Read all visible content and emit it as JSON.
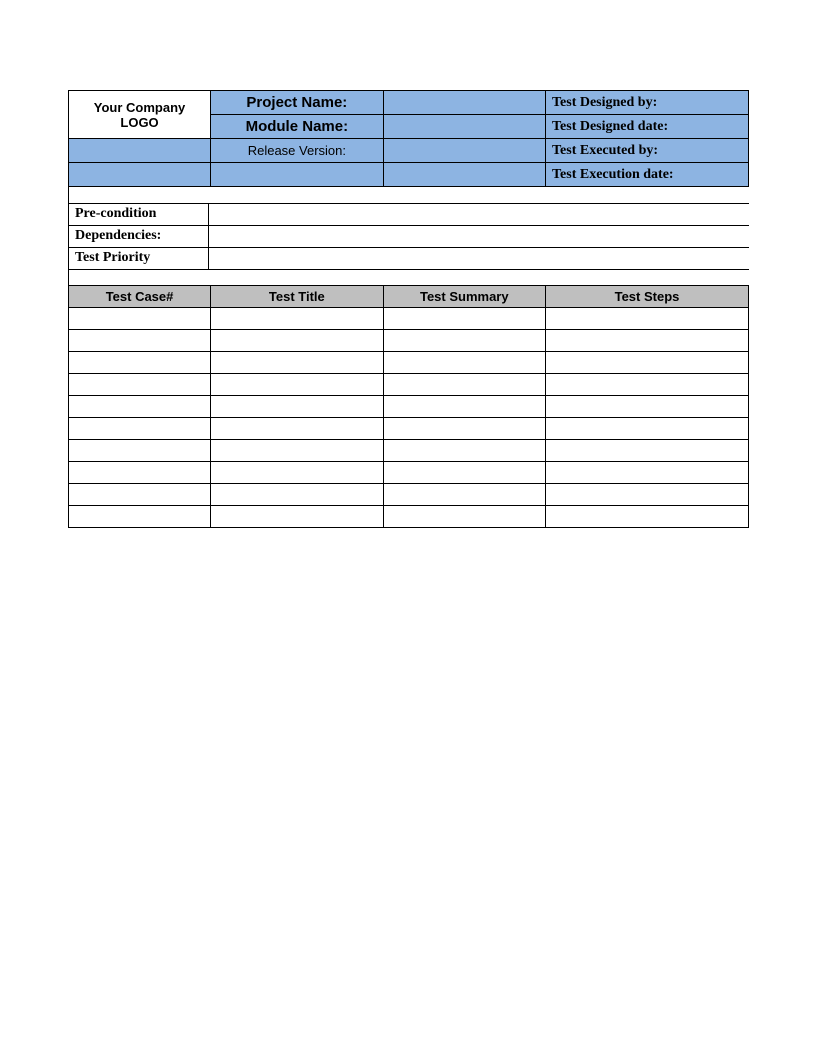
{
  "header": {
    "logo_text": "Your Company LOGO",
    "project_name_label": "Project Name:",
    "module_name_label": "Module Name:",
    "release_version_label": "Release Version:",
    "test_designed_by_label": "Test Designed by:",
    "test_designed_date_label": "Test Designed date:",
    "test_executed_by_label": "Test Executed by:",
    "test_execution_date_label": "Test Execution date:",
    "project_name_value": "",
    "module_name_value": "",
    "release_version_value": "",
    "test_designed_by_value": "",
    "test_designed_date_value": "",
    "test_executed_by_value": "",
    "test_execution_date_value": ""
  },
  "meta": {
    "pre_condition_label": "Pre-condition",
    "dependencies_label": "Dependencies:",
    "test_priority_label": "Test Priority",
    "pre_condition_value": "",
    "dependencies_value": "",
    "test_priority_value": ""
  },
  "columns": {
    "c1": "Test Case#",
    "c2": "Test Title",
    "c3": "Test Summary",
    "c4": "Test Steps"
  },
  "rows": [
    {
      "c1": "",
      "c2": "",
      "c3": "",
      "c4": ""
    },
    {
      "c1": "",
      "c2": "",
      "c3": "",
      "c4": ""
    },
    {
      "c1": "",
      "c2": "",
      "c3": "",
      "c4": ""
    },
    {
      "c1": "",
      "c2": "",
      "c3": "",
      "c4": ""
    },
    {
      "c1": "",
      "c2": "",
      "c3": "",
      "c4": ""
    },
    {
      "c1": "",
      "c2": "",
      "c3": "",
      "c4": ""
    },
    {
      "c1": "",
      "c2": "",
      "c3": "",
      "c4": ""
    },
    {
      "c1": "",
      "c2": "",
      "c3": "",
      "c4": ""
    },
    {
      "c1": "",
      "c2": "",
      "c3": "",
      "c4": ""
    },
    {
      "c1": "",
      "c2": "",
      "c3": "",
      "c4": ""
    }
  ]
}
